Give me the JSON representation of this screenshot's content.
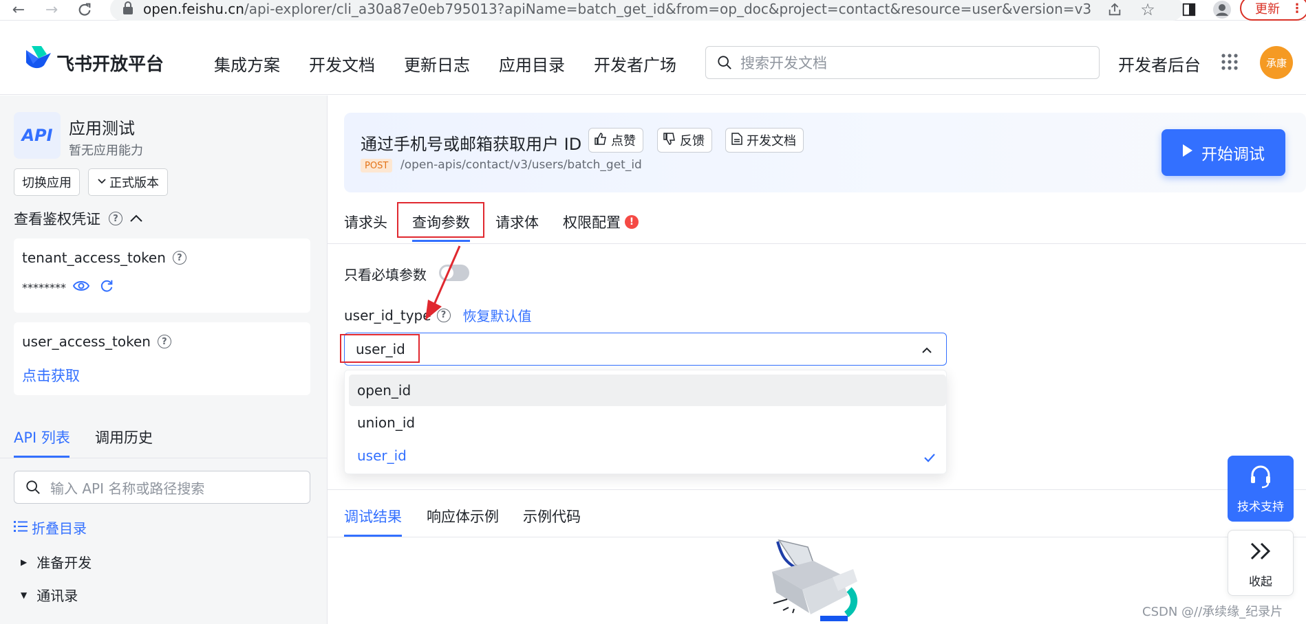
{
  "browser": {
    "url_host": "open.feishu.cn",
    "url_path": "/api-explorer/cli_a30a87e0eb795013?apiName=batch_get_id&from=op_doc&project=contact&resource=user&version=v3",
    "update_label": "更新"
  },
  "header": {
    "logo_text": "飞书开放平台",
    "nav": [
      "集成方案",
      "开发文档",
      "更新日志",
      "应用目录",
      "开发者广场"
    ],
    "search_placeholder": "搜索开发文档",
    "dev_console": "开发者后台",
    "avatar_text": "承康"
  },
  "sidebar": {
    "app_badge": "API",
    "app_name": "应用测试",
    "app_desc": "暂无应用能力",
    "switch_app": "切换应用",
    "version_select": "正式版本",
    "auth_title": "查看鉴权凭证",
    "tenant_token_label": "tenant_access_token",
    "tenant_token_value": "********",
    "user_token_label": "user_access_token",
    "user_token_action": "点击获取",
    "tabs": [
      "API 列表",
      "调用历史"
    ],
    "api_search_placeholder": "输入 API 名称或路径搜索",
    "collapse_label": "折叠目录",
    "tree": [
      {
        "label": "准备开发",
        "expanded": false
      },
      {
        "label": "通讯录",
        "expanded": true
      }
    ]
  },
  "banner": {
    "title": "通过手机号或邮箱获取用户 ID",
    "like": "点赞",
    "feedback": "反馈",
    "docs": "开发文档",
    "method": "POST",
    "path": "/open-apis/contact/v3/users/batch_get_id",
    "start_debug": "开始调试"
  },
  "param_tabs": [
    "请求头",
    "查询参数",
    "请求体",
    "权限配置"
  ],
  "active_param_tab": "查询参数",
  "params": {
    "required_only_label": "只看必填参数",
    "required_only_on": false,
    "field_name": "user_id_type",
    "restore_default": "恢复默认值",
    "selected_value": "user_id",
    "options": [
      "open_id",
      "union_id",
      "user_id"
    ]
  },
  "result_tabs": [
    "调试结果",
    "响应体示例",
    "示例代码"
  ],
  "active_result_tab": "调试结果",
  "floating": {
    "support_label": "技术支持",
    "collapse_label": "收起"
  },
  "watermark": "CSDN @//承续缘_纪录片",
  "colors": {
    "accent": "#3370ff",
    "annotation_red": "#e0282f",
    "avatar_orange": "#f59a23"
  }
}
